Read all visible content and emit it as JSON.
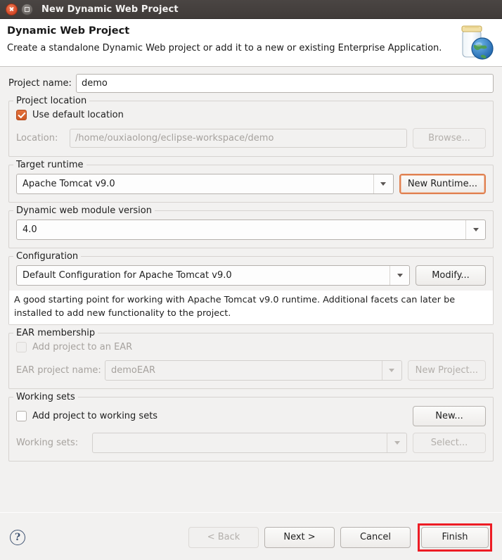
{
  "window": {
    "title": "New Dynamic Web Project",
    "close_icon": "close-icon",
    "maximize_icon": "maximize-icon"
  },
  "banner": {
    "title": "Dynamic Web Project",
    "description": "Create a standalone Dynamic Web project or add it to a new or existing Enterprise Application.",
    "icon": "web-project-jar-globe-icon"
  },
  "project_name": {
    "label": "Project name:",
    "value": "demo"
  },
  "project_location": {
    "group_label": "Project location",
    "use_default_label": "Use default location",
    "use_default_checked": true,
    "location_label": "Location:",
    "location_value": "/home/ouxiaolong/eclipse-workspace/demo",
    "browse_label": "Browse...",
    "browse_enabled": false
  },
  "target_runtime": {
    "group_label": "Target runtime",
    "value": "Apache Tomcat v9.0",
    "new_runtime_label": "New Runtime...",
    "new_runtime_focused": true
  },
  "module_version": {
    "group_label": "Dynamic web module version",
    "value": "4.0"
  },
  "configuration": {
    "group_label": "Configuration",
    "value": "Default Configuration for Apache Tomcat v9.0",
    "modify_label": "Modify...",
    "description": "A good starting point for working with Apache Tomcat v9.0 runtime. Additional facets can later be installed to add new functionality to the project."
  },
  "ear_membership": {
    "group_label": "EAR membership",
    "add_to_ear_label": "Add project to an EAR",
    "add_to_ear_checked": false,
    "ear_project_name_label": "EAR project name:",
    "ear_project_name_value": "demoEAR",
    "new_project_label": "New Project...",
    "enabled": false
  },
  "working_sets": {
    "group_label": "Working sets",
    "add_to_working_sets_label": "Add project to working sets",
    "add_to_working_sets_checked": false,
    "new_label": "New...",
    "working_sets_label": "Working sets:",
    "working_sets_value": "",
    "select_label": "Select...",
    "select_enabled": false
  },
  "footer": {
    "help_icon": "help-icon",
    "help_glyph": "?",
    "back_label": "< Back",
    "back_enabled": false,
    "next_label": "Next >",
    "cancel_label": "Cancel",
    "finish_label": "Finish",
    "finish_highlight_color": "#ed1c24"
  }
}
